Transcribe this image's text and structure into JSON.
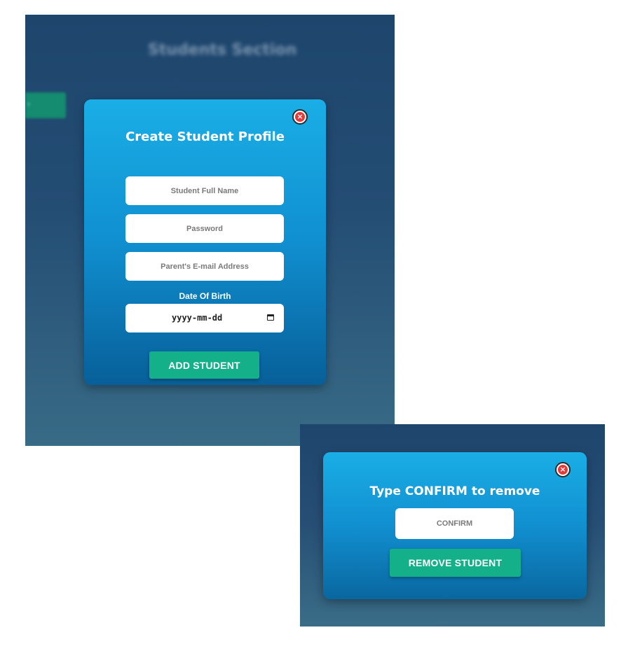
{
  "background": {
    "section_title": "Students Section"
  },
  "create_modal": {
    "title": "Create Student Profile",
    "close_symbol": "×",
    "full_name_placeholder": "Student Full Name",
    "password_placeholder": "Password",
    "email_placeholder": "Parent's E-mail Address",
    "dob_label": "Date Of Birth",
    "dob_value": "yyyy-mm-dd",
    "submit_label": "ADD STUDENT"
  },
  "remove_modal": {
    "title": "Type CONFIRM to remove",
    "close_symbol": "×",
    "confirm_placeholder": "CONFIRM",
    "submit_label": "REMOVE STUDENT"
  },
  "colors": {
    "modal_gradient_top": "#1aaee6",
    "modal_gradient_bottom": "#075f98",
    "button_green": "#14b08a",
    "close_red": "#e53a3a",
    "page_background": "#1e466d"
  },
  "icons": {
    "close": "close-circle-icon",
    "calendar": "calendar-icon"
  }
}
